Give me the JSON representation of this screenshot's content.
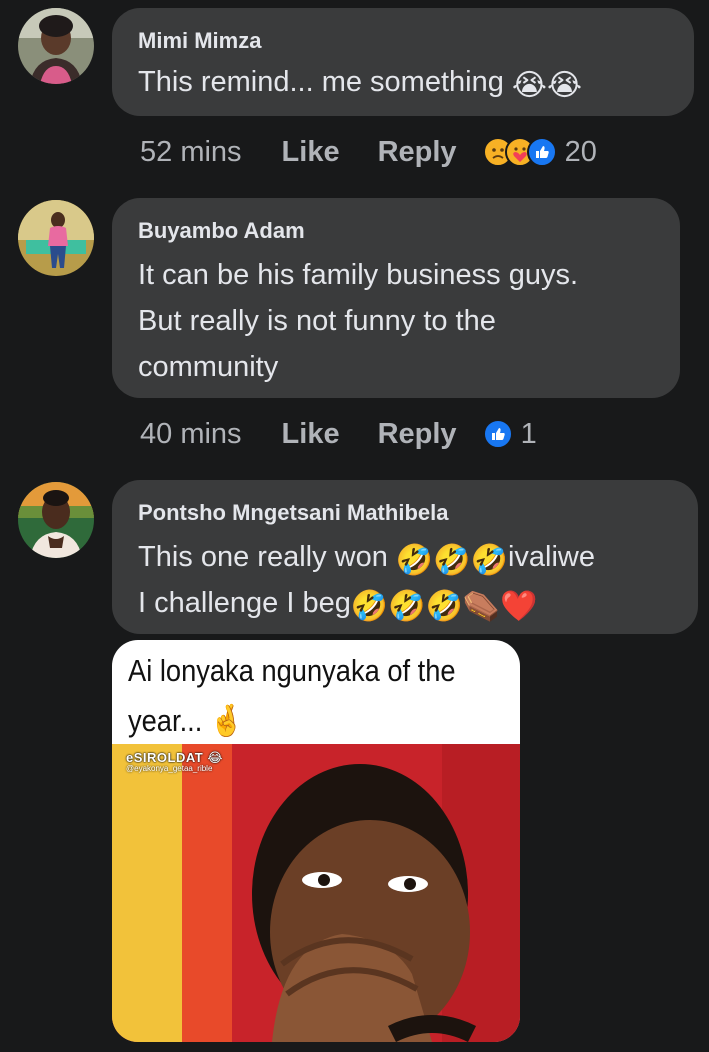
{
  "comments": [
    {
      "author": "Mimi Mimza",
      "text": "This remind... me something",
      "emoji": "😭😭",
      "time": "52 mins",
      "like_label": "Like",
      "reply_label": "Reply",
      "reactions": [
        "sad",
        "care",
        "like"
      ],
      "reaction_count": "20"
    },
    {
      "author": "Buyambo Adam",
      "text": "It can be his family business guys.\nBut really is not funny to the\ncommunity",
      "time": "40 mins",
      "like_label": "Like",
      "reply_label": "Reply",
      "reactions": [
        "like"
      ],
      "reaction_count": "1"
    },
    {
      "author": "Pontsho Mngetsani Mathibela",
      "line1_text": "This one really won ",
      "line1_emoji": "🤣🤣🤣",
      "line1_tail": "ivaliwe",
      "line2_text": "I challenge I beg",
      "line2_emoji": "🤣🤣🤣⚰️❤️",
      "meme": {
        "caption": "Ai lonyaka ngunyaka of the year... 🤞",
        "watermark": "eSIROLDAT 😂",
        "watermark_sub": "@eyakonya_getaa_rible"
      }
    }
  ],
  "colors": {
    "background": "#18191a",
    "bubble": "#3a3b3c",
    "text_primary": "#e4e6eb",
    "text_secondary": "#b0b3b8",
    "like_blue": "#1877f2",
    "reaction_yellow": "#f7b125"
  }
}
